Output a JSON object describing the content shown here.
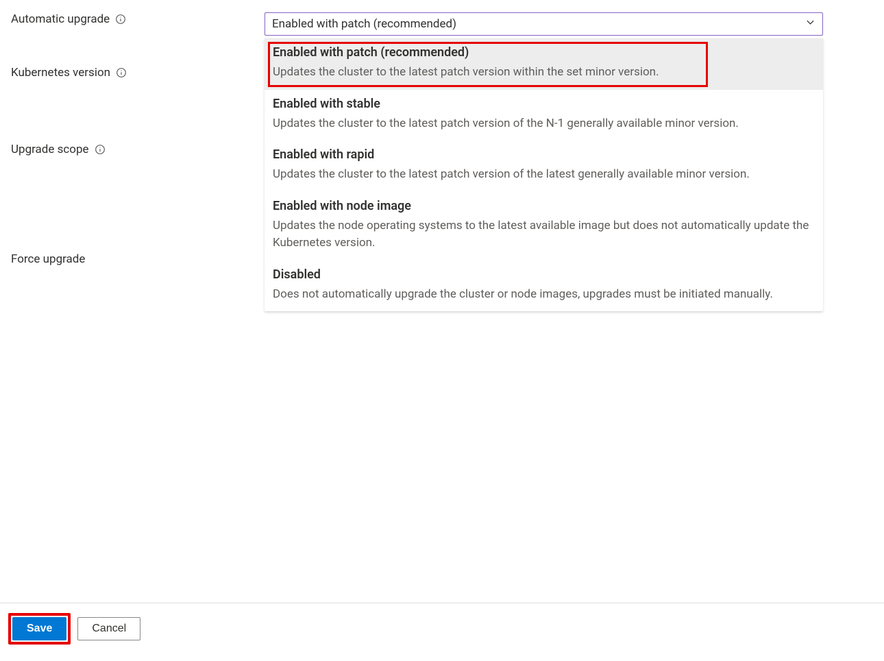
{
  "labels": {
    "automatic_upgrade": "Automatic upgrade",
    "kubernetes_version": "Kubernetes version",
    "upgrade_scope": "Upgrade scope",
    "force_upgrade": "Force upgrade"
  },
  "select": {
    "value": "Enabled with patch (recommended)"
  },
  "options": [
    {
      "title": "Enabled with patch (recommended)",
      "desc": "Updates the cluster to the latest patch version within the set minor version."
    },
    {
      "title": "Enabled with stable",
      "desc": "Updates the cluster to the latest patch version of the N-1 generally available minor version."
    },
    {
      "title": "Enabled with rapid",
      "desc": "Updates the cluster to the latest patch version of the latest generally available minor version."
    },
    {
      "title": "Enabled with node image",
      "desc": "Updates the node operating systems to the latest available image but does not automatically update the Kubernetes version."
    },
    {
      "title": "Disabled",
      "desc": "Does not automatically upgrade the cluster or node images, upgrades must be initiated manually."
    }
  ],
  "footer": {
    "save": "Save",
    "cancel": "Cancel"
  }
}
